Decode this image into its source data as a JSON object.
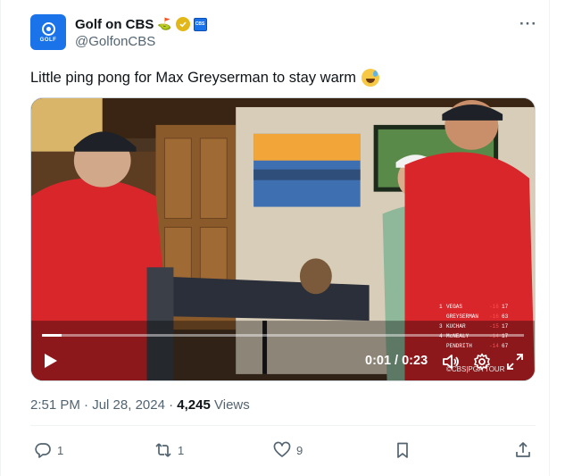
{
  "author": {
    "display_name": "Golf on CBS",
    "handle": "@GolfonCBS",
    "avatar_text": "GOLF",
    "flag_emoji": "⛳"
  },
  "tweet": {
    "text": "Little ping pong for Max Greyserman to stay warm"
  },
  "video": {
    "time_label": "0:01 / 0:23",
    "progress": 0.04,
    "watermark": "©CBS|PGA TOUR",
    "leaderboard": [
      {
        "pos": "1",
        "name": "VEGAS",
        "score": "-16",
        "thru": "17"
      },
      {
        "pos": "",
        "name": "GREYSERMAN",
        "score": "-16",
        "thru": "63"
      },
      {
        "pos": "3",
        "name": "KUCHAR",
        "score": "-15",
        "thru": "17"
      },
      {
        "pos": "4",
        "name": "McNEALY",
        "score": "-14",
        "thru": "17"
      },
      {
        "pos": "",
        "name": "PENDRITH",
        "score": "-14",
        "thru": "67"
      }
    ]
  },
  "meta": {
    "time": "2:51 PM",
    "date": "Jul 28, 2024",
    "views_count": "4,245",
    "views_label": "Views"
  },
  "actions": {
    "replies": "1",
    "retweets": "1",
    "likes": "9"
  },
  "colors": {
    "accent": "#1d9bf0",
    "text": "#0f1419",
    "muted": "#536471",
    "verified_gold": "#e2b719",
    "cbs_blue": "#1a73e8"
  }
}
